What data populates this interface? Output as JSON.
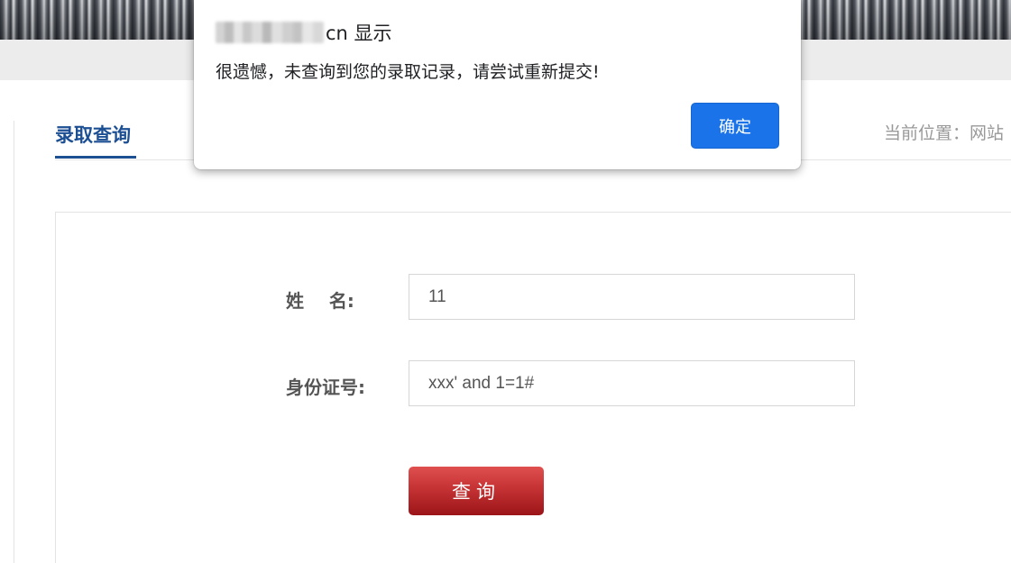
{
  "dialog": {
    "title_suffix": "cn 显示",
    "message": "很遗憾，未查询到您的录取记录，请尝试重新提交!",
    "ok_label": "确定"
  },
  "tab": {
    "title": "录取查询"
  },
  "breadcrumb": {
    "text": "当前位置：网站"
  },
  "form": {
    "name_label": "姓    名:",
    "name_value": "11",
    "id_label": "身份证号:",
    "id_value": "xxx' and 1=1#",
    "submit_label": "查询"
  },
  "colors": {
    "accent_blue": "#1c4f93",
    "dialog_button": "#1a73e8",
    "query_button": "#c53234"
  }
}
